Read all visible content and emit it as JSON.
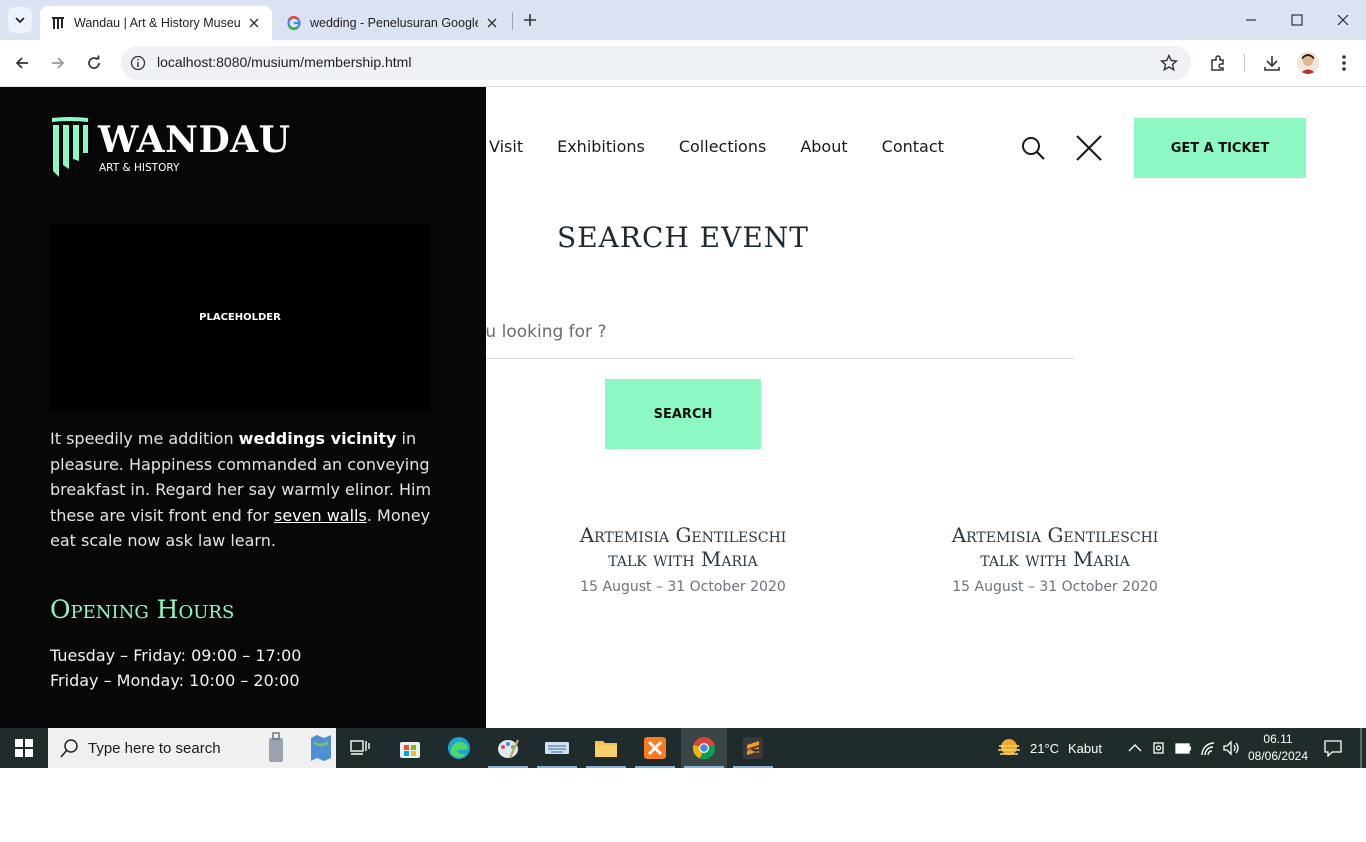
{
  "browser": {
    "tabs": [
      {
        "title": "Wandau | Art & History Museum",
        "active": true
      },
      {
        "title": "wedding - Penelusuran Google",
        "active": false
      }
    ],
    "url": "localhost:8080/musium/membership.html"
  },
  "header": {
    "nav": [
      "Visit",
      "Exhibitions",
      "Collections",
      "About",
      "Contact"
    ],
    "ticket_label": "GET A TICKET"
  },
  "search": {
    "title": "SEARCH EVENT",
    "placeholder": "What are you looking for ?",
    "button_label": "SEARCH"
  },
  "events": [
    {
      "title_line1": "Artemisia Gentileschi",
      "title_line2": "talk with Maria",
      "date": "15 August – 31 October 2020"
    },
    {
      "title_line1": "Artemisia Gentileschi",
      "title_line2": "talk with Maria",
      "date": "15 August – 31 October 2020"
    }
  ],
  "drawer": {
    "logo_word": "WANDAU",
    "logo_sub": "ART & HISTORY",
    "placeholder_label": "PLACEHOLDER",
    "text_a": "It speedily me addition ",
    "text_bold": "weddings vicinity",
    "text_b": " in pleasure. Happiness commanded an conveying breakfast in. Regard her say warmly elinor. Him these are visit front end for ",
    "text_link": "seven walls",
    "text_c": ". Money eat scale now ask law learn.",
    "hours_title": "Opening Hours",
    "hours": [
      "Tuesday – Friday: 09:00 – 17:00",
      "Friday – Monday: 10:00 – 20:00"
    ]
  },
  "taskbar": {
    "search_placeholder": "Type here to search",
    "weather_temp": "21°C",
    "weather_desc": "Kabut",
    "time": "06.11",
    "date": "08/06/2024"
  },
  "colors": {
    "accent": "#8df8c3",
    "drawer_bg": "#070707",
    "taskbar_bg": "#202b2b"
  }
}
